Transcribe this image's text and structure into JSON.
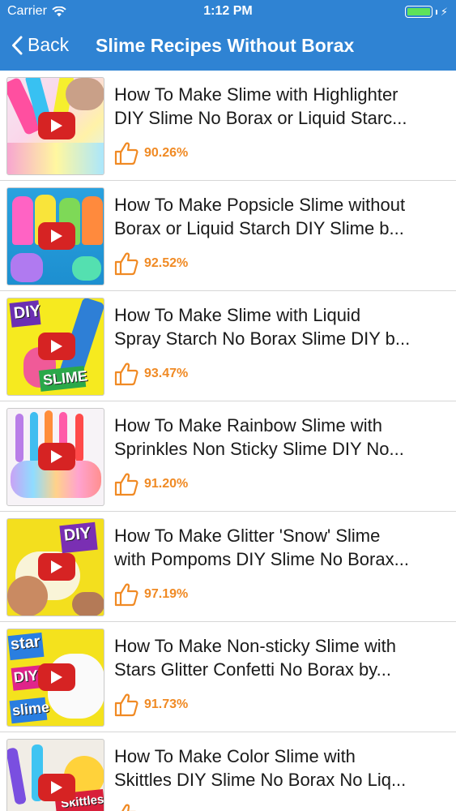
{
  "status_bar": {
    "carrier": "Carrier",
    "time": "1:12 PM",
    "battery_color": "#5ee25a"
  },
  "nav": {
    "back_label": "Back",
    "title": "Slime Recipes Without Borax",
    "bar_color": "#2f83d3"
  },
  "accent_color": "#f08a24",
  "videos": [
    {
      "line1": "How To Make Slime with Highlighter",
      "line2": "DIY Slime No Borax or Liquid Starc...",
      "rating": "90.26%"
    },
    {
      "line1": "How To Make Popsicle Slime without",
      "line2": "Borax or Liquid Starch DIY Slime b...",
      "rating": "92.52%"
    },
    {
      "line1": "How To Make Slime with Liquid",
      "line2": "Spray Starch No Borax Slime DIY b...",
      "rating": "93.47%",
      "thumb_text": [
        "DIY",
        "SLIME"
      ]
    },
    {
      "line1": "How To Make Rainbow Slime with",
      "line2": "Sprinkles Non Sticky Slime DIY No...",
      "rating": "91.20%"
    },
    {
      "line1": "How To Make Glitter 'Snow' Slime",
      "line2": "with Pompoms DIY Slime No Borax...",
      "rating": "97.19%",
      "thumb_text": [
        "DIY"
      ]
    },
    {
      "line1": "How To Make Non-sticky Slime with",
      "line2": "Stars Glitter Confetti No Borax by...",
      "rating": "91.73%",
      "thumb_text": [
        "star",
        "DIY",
        "slime"
      ]
    },
    {
      "line1": "How To Make Color Slime with",
      "line2": "Skittles DIY Slime No Borax No Liq...",
      "rating": "",
      "thumb_text": [
        "Skittles"
      ]
    }
  ]
}
